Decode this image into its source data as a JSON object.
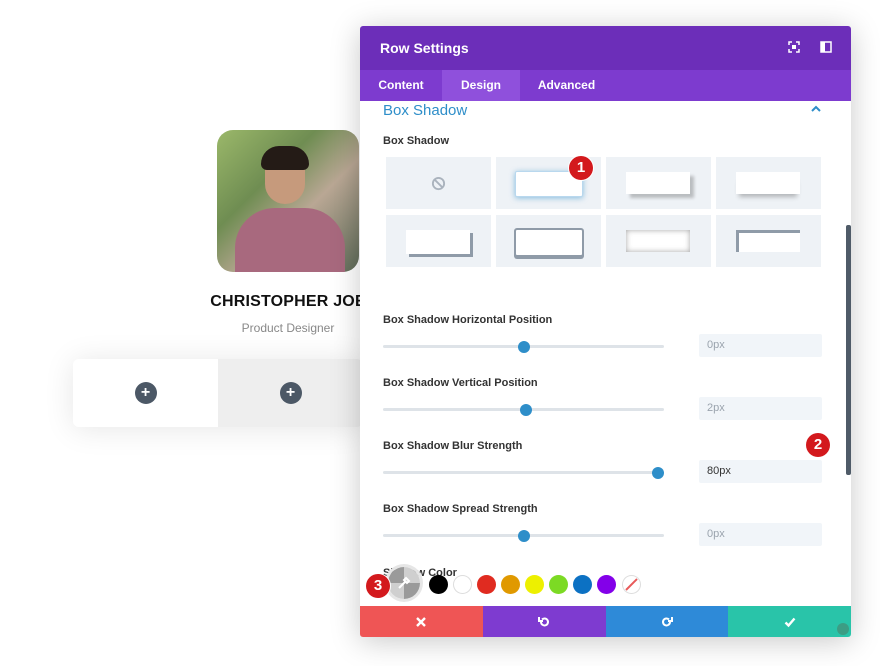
{
  "profile": {
    "name": "CHRISTOPHER JOE",
    "role": "Product Designer"
  },
  "modal": {
    "title": "Row Settings",
    "header_icons": [
      "fullscreen-icon",
      "sidebar-toggle-icon"
    ],
    "tabs": [
      {
        "label": "Content",
        "active": false
      },
      {
        "label": "Design",
        "active": true
      },
      {
        "label": "Advanced",
        "active": false
      }
    ],
    "section_title": "Box Shadow",
    "box_shadow_label": "Box Shadow",
    "presets": [
      "none",
      "preset-1",
      "preset-2",
      "preset-3",
      "preset-4",
      "preset-5",
      "preset-6",
      "preset-7"
    ],
    "selected_preset": "preset-1",
    "sliders": [
      {
        "label": "Box Shadow Horizontal Position",
        "value": "0px",
        "fraction": 0.5
      },
      {
        "label": "Box Shadow Vertical Position",
        "value": "2px",
        "fraction": 0.51
      },
      {
        "label": "Box Shadow Blur Strength",
        "value": "80px",
        "fraction": 0.98
      },
      {
        "label": "Box Shadow Spread Strength",
        "value": "0px",
        "fraction": 0.5
      }
    ],
    "shadow_color_label": "Shadow Color",
    "swatches": [
      "#000000",
      "#ffffff",
      "#e02b20",
      "#e09900",
      "#edf000",
      "#7cda24",
      "#0c71c3",
      "#8300e9"
    ],
    "footer_buttons": [
      {
        "name": "cancel",
        "icon": "close-icon",
        "color": "#ef5555"
      },
      {
        "name": "undo",
        "icon": "undo-icon",
        "color": "#7e3bd0"
      },
      {
        "name": "redo",
        "icon": "redo-icon",
        "color": "#2e8ad8"
      },
      {
        "name": "save",
        "icon": "check-icon",
        "color": "#29c4a9"
      }
    ]
  },
  "annotations": [
    "1",
    "2",
    "3"
  ],
  "colors": {
    "header": "#6c2eb9",
    "tabs": "#7d3bcf",
    "accent": "#2e8ec9",
    "badge": "#d3191d"
  }
}
